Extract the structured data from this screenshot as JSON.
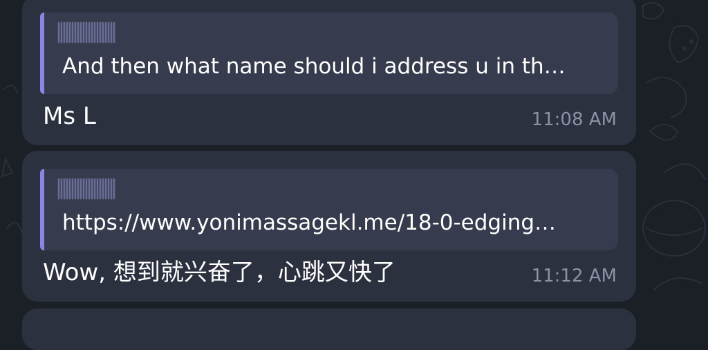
{
  "messages": [
    {
      "reply_preview": "And then what name should i address u in th…",
      "text": "Ms L",
      "time": "11:08 AM"
    },
    {
      "reply_preview": "https://www.yonimassagekl.me/18-0-edging…",
      "text": "Wow, 想到就兴奋了，心跳又快了",
      "time": "11:12 AM"
    }
  ],
  "colors": {
    "background": "#1b1f26",
    "bubble": "#2c3140",
    "reply_box": "#363c4d",
    "reply_accent": "#8a86e8",
    "time_text": "#8a93a6"
  }
}
